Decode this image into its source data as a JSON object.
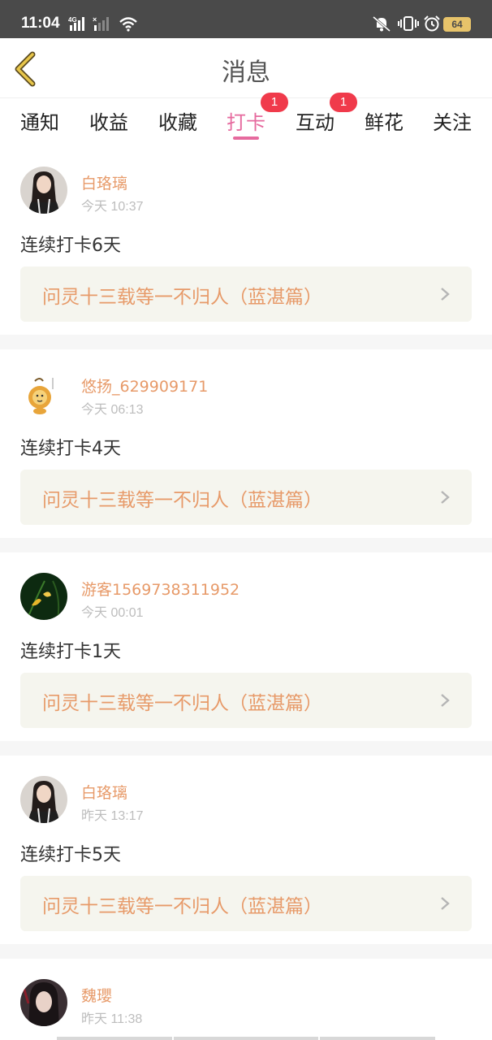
{
  "status_bar": {
    "time": "11:04",
    "battery": "64"
  },
  "header": {
    "title": "消息"
  },
  "tabs": [
    {
      "label": "通知"
    },
    {
      "label": "收益"
    },
    {
      "label": "收藏"
    },
    {
      "label": "打卡",
      "badge": "1",
      "active": true
    },
    {
      "label": "互动",
      "badge": "1"
    },
    {
      "label": "鲜花"
    },
    {
      "label": "关注"
    }
  ],
  "feed": [
    {
      "username": "白珞璃",
      "time": "今天 10:37",
      "message": "连续打卡6天",
      "book": "问灵十三载等一不归人（蓝湛篇）"
    },
    {
      "username": "悠扬_629909171",
      "time": "今天 06:13",
      "message": "连续打卡4天",
      "book": "问灵十三载等一不归人（蓝湛篇）"
    },
    {
      "username": "游客1569738311952",
      "time": "今天 00:01",
      "message": "连续打卡1天",
      "book": "问灵十三载等一不归人（蓝湛篇）"
    },
    {
      "username": "白珞璃",
      "time": "昨天 13:17",
      "message": "连续打卡5天",
      "book": "问灵十三载等一不归人（蓝湛篇）"
    },
    {
      "username": "魏瓔",
      "time": "昨天 11:38"
    }
  ],
  "colors": {
    "accent": "#e66a9e",
    "name": "#e79a69",
    "badge": "#f03a4b"
  }
}
